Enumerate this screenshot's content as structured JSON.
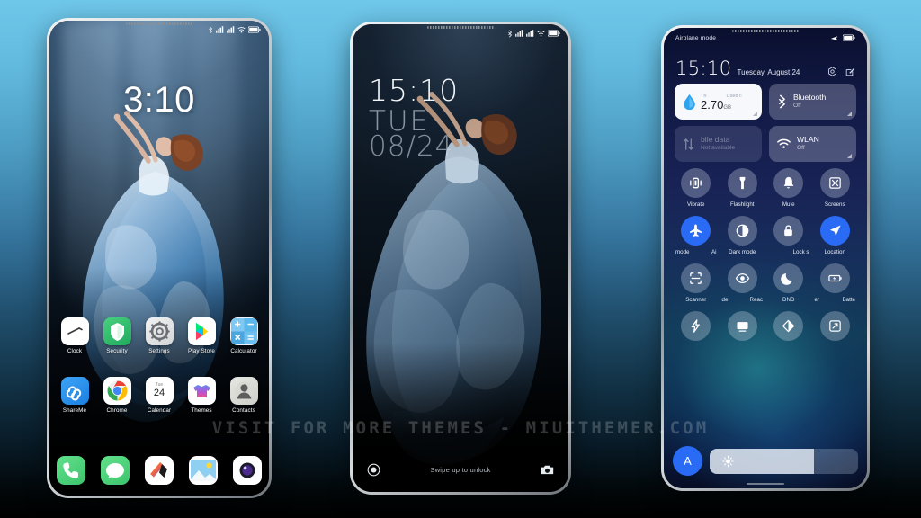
{
  "background": {
    "top_color": "#6ec6e8",
    "bottom_color": "#000000"
  },
  "watermark": {
    "text": "VISIT FOR MORE THEMES - MIUITHEMER.COM"
  },
  "phone_home": {
    "status_bar": {
      "icons": [
        "bluetooth-icon",
        "signal-icon",
        "signal-icon",
        "wifi-icon",
        "battery-icon"
      ]
    },
    "clock": "3:10",
    "apps_row1": [
      {
        "label": "Clock",
        "icon": "clock-icon"
      },
      {
        "label": "Security",
        "icon": "shield-icon"
      },
      {
        "label": "Settings",
        "icon": "gear-icon"
      },
      {
        "label": "Play Store",
        "icon": "play-store-icon"
      },
      {
        "label": "Calculator",
        "icon": "calculator-icon"
      }
    ],
    "apps_row2": [
      {
        "label": "ShareMe",
        "icon": "shareme-icon"
      },
      {
        "label": "Chrome",
        "icon": "chrome-icon"
      },
      {
        "label": "Calendar",
        "icon": "calendar-icon",
        "day_name": "Tue",
        "day_num": "24"
      },
      {
        "label": "Themes",
        "icon": "themes-icon"
      },
      {
        "label": "Contacts",
        "icon": "contacts-icon"
      }
    ],
    "dock": [
      {
        "label": "Phone",
        "icon": "phone-icon"
      },
      {
        "label": "Messages",
        "icon": "messages-icon"
      },
      {
        "label": "Notes",
        "icon": "notes-icon"
      },
      {
        "label": "Gallery",
        "icon": "gallery-icon"
      },
      {
        "label": "Camera",
        "icon": "camera-icon"
      }
    ]
  },
  "phone_lock": {
    "status_bar": {
      "icons": [
        "bluetooth-icon",
        "signal-icon",
        "signal-icon",
        "wifi-icon",
        "battery-icon"
      ]
    },
    "time": "15:10",
    "weekday": "TUE",
    "date": "08/24",
    "hint": "Swipe up to unlock",
    "left_icon": "record-circle-icon",
    "right_icon": "camera-icon"
  },
  "phone_control_center": {
    "airplane_label": "Airplane mode",
    "status_icons": [
      "airplane-icon",
      "battery-icon"
    ],
    "time": "15:10",
    "date": "Tuesday, August 24",
    "header_icons": [
      "settings-gear-icon",
      "edit-icon"
    ],
    "cards": [
      {
        "name": "data-usage",
        "icon": "water-drop-icon",
        "small_left": "Th",
        "small_right": "Used t:",
        "value": "2.70",
        "unit": "GB",
        "style": "light"
      },
      {
        "name": "bluetooth",
        "icon": "bluetooth-icon",
        "title": "Bluetooth",
        "subtitle": "Off",
        "style": "tint"
      },
      {
        "name": "mobile-data",
        "icon": "data-transfer-icon",
        "title": "bile data",
        "subtitle": "Not available",
        "style": "dim"
      },
      {
        "name": "wlan",
        "icon": "wifi-icon",
        "title": "WLAN",
        "subtitle": "Off",
        "style": "tint"
      }
    ],
    "toggles": [
      {
        "label": "Vibrate",
        "icon": "vibrate-icon",
        "active": false
      },
      {
        "label": "Flashlight",
        "icon": "flashlight-icon",
        "active": false
      },
      {
        "label": "Mute",
        "icon": "bell-icon",
        "active": false
      },
      {
        "label": "Screens",
        "icon": "screenshot-icon",
        "active": false
      },
      {
        "label": "mode",
        "label2": "Ai",
        "icon": "airplane-icon",
        "active": true
      },
      {
        "label": "Dark mode",
        "icon": "contrast-icon",
        "active": false
      },
      {
        "label": "Lock s",
        "label2": "",
        "icon": "lock-icon",
        "active": false
      },
      {
        "label": "Location",
        "icon": "location-arrow-icon",
        "active": true
      },
      {
        "label": "Scanner",
        "icon": "scan-icon",
        "active": false
      },
      {
        "label": "de",
        "label2": "Reac",
        "icon": "eye-icon",
        "active": false
      },
      {
        "label": "DND",
        "icon": "moon-icon",
        "active": false
      },
      {
        "label": "er",
        "label2": "Batte",
        "icon": "battery-saver-icon",
        "active": false
      },
      {
        "label": "",
        "icon": "lightning-icon",
        "active": false
      },
      {
        "label": "",
        "icon": "cast-icon",
        "active": false
      },
      {
        "label": "",
        "icon": "half-tone-icon",
        "active": false
      },
      {
        "label": "",
        "icon": "expand-icon",
        "active": false
      }
    ],
    "brightness": {
      "auto_label": "A",
      "icon": "sun-icon",
      "fill_percent": 70
    },
    "accent_color": "#2a6bf6"
  }
}
